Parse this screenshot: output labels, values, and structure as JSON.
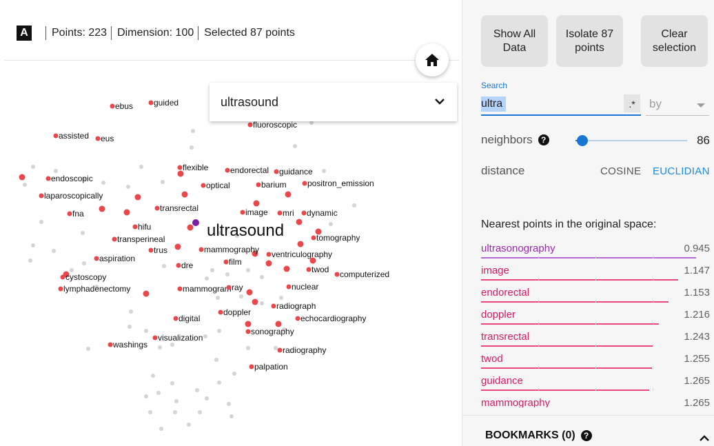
{
  "header": {
    "logo": "A",
    "points": "Points: 223",
    "dimension": "Dimension: 100",
    "selected": "Selected 87 points"
  },
  "icons": {
    "home": "home-icon",
    "dropdown": "chevron-down-icon",
    "help": "help-icon",
    "collapse": "chevron-up-icon"
  },
  "label_dropdown": {
    "value": "ultrasound"
  },
  "projection": {
    "focus_label": "ultrasound",
    "colors": {
      "selected": "#e8474c",
      "focus": "#7b1fa2",
      "unselected": "#d4d4d4"
    },
    "labels": [
      "ebus",
      "guided",
      "fluoroscopic",
      "assisted",
      "eus",
      "flexible",
      "endorectal",
      "guidance",
      "endoscopic",
      "optical",
      "barium",
      "positron_emission",
      "laparoscopically",
      "transrectal",
      "image",
      "mri",
      "dynamic",
      "fna",
      "hifu",
      "tomography",
      "transperineal",
      "trus",
      "mammography",
      "ventriculography",
      "aspiration",
      "film",
      "dre",
      "twod",
      "computerized",
      "cystoscopy",
      "nuclear",
      "lymphadenectomy",
      "mammogram",
      "ray",
      "radiograph",
      "doppler",
      "digital",
      "echocardiography",
      "sonography",
      "visualization",
      "washings",
      "radiography",
      "palpation"
    ]
  },
  "panel": {
    "buttons": {
      "show_all": "Show All Data",
      "isolate": "Isolate 87 points",
      "clear": "Clear selection"
    },
    "search": {
      "label": "Search",
      "value": "ultra",
      "regex": ".*",
      "by_placeholder": "by"
    },
    "neighbors": {
      "label": "neighbors",
      "value": "86",
      "level": 0.06
    },
    "distance": {
      "label": "distance",
      "cosine": "COSINE",
      "euclidian": "EUCLIDIAN",
      "active": "euclidian"
    },
    "nearest": {
      "title": "Nearest points in the original space:",
      "colors": {
        "top": "#9c27b0",
        "rest": "#d81b60",
        "bar_top": "#b36ad6",
        "bar_rest": "#e8477a"
      },
      "items": [
        {
          "word": "ultrasonography",
          "dist": "0.945"
        },
        {
          "word": "image",
          "dist": "1.147"
        },
        {
          "word": "endorectal",
          "dist": "1.153"
        },
        {
          "word": "doppler",
          "dist": "1.216"
        },
        {
          "word": "transrectal",
          "dist": "1.243"
        },
        {
          "word": "twod",
          "dist": "1.255"
        },
        {
          "word": "guidance",
          "dist": "1.265"
        },
        {
          "word": "mammography",
          "dist": "1.265"
        }
      ]
    },
    "bookmarks": {
      "title": "BOOKMARKS (0)"
    }
  }
}
